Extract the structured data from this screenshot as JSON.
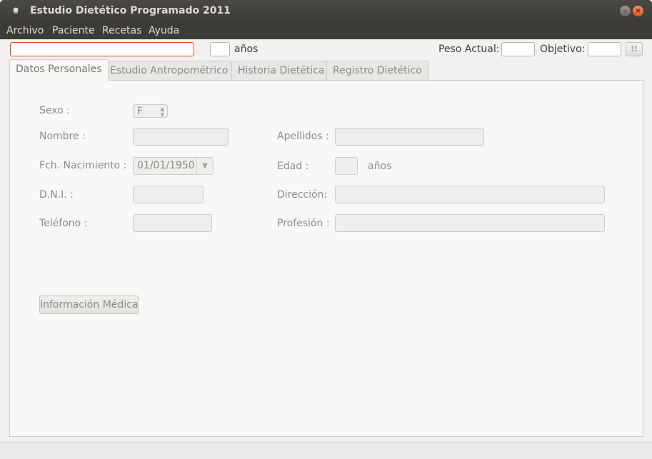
{
  "window": {
    "title": "Estudio Dietético Programado 2011"
  },
  "menu": [
    "Archivo",
    "Paciente",
    "Recetas",
    "Ayuda"
  ],
  "topbar": {
    "name_value": "",
    "age_value": "",
    "age_unit": "años",
    "peso_label": "Peso Actual:",
    "peso_value": "",
    "objetivo_label": "Objetivo:",
    "objetivo_value": "",
    "alert_button": "!!"
  },
  "tabs": [
    {
      "label": "Datos Personales",
      "active": true
    },
    {
      "label": "Estudio Antropométrico",
      "active": false
    },
    {
      "label": "Historia Dietética",
      "active": false
    },
    {
      "label": "Registro Dietético",
      "active": false
    }
  ],
  "form": {
    "sexo_label": "Sexo :",
    "sexo_value": "F",
    "nombre_label": "Nombre :",
    "nombre_value": "",
    "apellidos_label": "Apellidos :",
    "apellidos_value": "",
    "fecha_label": "Fch. Nacimiento :",
    "fecha_value": "01/01/1950",
    "edad_label": "Edad :",
    "edad_value": "",
    "edad_unit": "años",
    "dni_label": "D.N.I. :",
    "dni_value": "",
    "direccion_label": "Dirección:",
    "direccion_value": "",
    "telefono_label": "Teléfono :",
    "telefono_value": "",
    "profesion_label": "Profesión :",
    "profesion_value": "",
    "info_button": "Información Médica"
  }
}
